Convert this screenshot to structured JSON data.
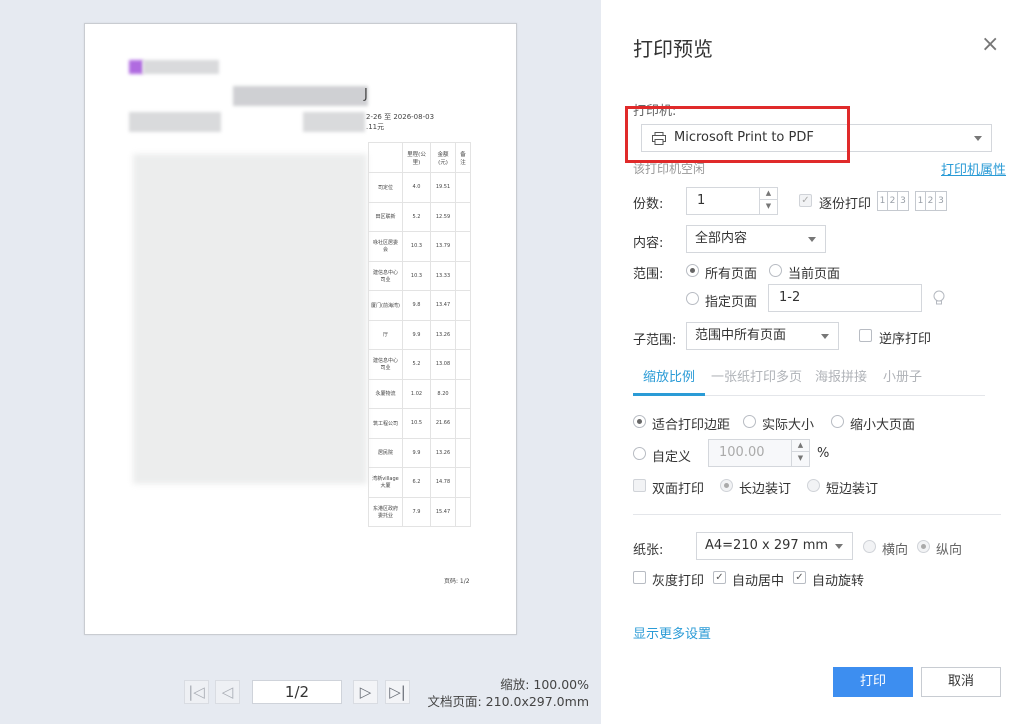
{
  "dialog": {
    "title": "打印预览",
    "close_symbol": "×"
  },
  "printer": {
    "label": "打印机:",
    "value": "Microsoft Print to PDF",
    "status": "该打印机空闲",
    "properties_link": "打印机属性"
  },
  "copies": {
    "label": "份数:",
    "value": "1",
    "collate_label": "逐份打印",
    "collate_checked": true,
    "collate_box_1": [
      "1",
      "2",
      "3"
    ],
    "collate_box_2": [
      "1",
      "2",
      "3"
    ]
  },
  "content": {
    "label": "内容:",
    "value": "全部内容"
  },
  "range": {
    "label": "范围:",
    "all_pages": "所有页面",
    "current_page": "当前页面",
    "specified_pages": "指定页面",
    "pages_value": "1-2"
  },
  "subrange": {
    "label": "子范围:",
    "value": "范围中所有页面",
    "reverse_label": "逆序打印"
  },
  "tabs": [
    {
      "label": "缩放比例",
      "active": true
    },
    {
      "label": "一张纸打印多页",
      "active": false
    },
    {
      "label": "海报拼接",
      "active": false
    },
    {
      "label": "小册子",
      "active": false
    }
  ],
  "scale": {
    "fit_margins": "适合打印边距",
    "actual_size": "实际大小",
    "shrink_large": "缩小大页面",
    "custom": "自定义",
    "custom_value": "100.00",
    "percent": "%",
    "duplex": "双面打印",
    "long_edge": "长边装订",
    "short_edge": "短边装订"
  },
  "paper": {
    "label": "纸张:",
    "value": "A4=210 x 297 mm",
    "landscape": "横向",
    "portrait": "纵向",
    "grayscale": "灰度打印",
    "auto_center": "自动居中",
    "auto_rotate": "自动旋转"
  },
  "more_settings": "显示更多设置",
  "buttons": {
    "print": "打印",
    "cancel": "取消"
  },
  "pager": {
    "page_value": "1/2",
    "first": "|◁",
    "prev": "◁",
    "next": "▷",
    "last": "▷|"
  },
  "zoom": {
    "zoom_text": "缩放: 100.00%",
    "doc_page_text": "文档页面: 210.0x297.0mm"
  },
  "preview": {
    "date_range": "2-26 至 2026-08-03",
    "amount": ".11元",
    "headers": [
      "里程(公里)",
      "金额(元)",
      "备注"
    ],
    "rows": [
      [
        "司定位",
        "4.0",
        "19.51"
      ],
      [
        "田区联新",
        "5.2",
        "12.59"
      ],
      [
        "咏社区居委会",
        "10.3",
        "13.79"
      ],
      [
        "建信息中心司业",
        "10.3",
        "13.33"
      ],
      [
        "厦门(前海湾)",
        "9.8",
        "13.47"
      ],
      [
        "厅",
        "9.9",
        "13.26"
      ],
      [
        "建信息中心司业",
        "5.2",
        "13.08"
      ],
      [
        "永厦物流",
        "1.02",
        "8.20"
      ],
      [
        "筑工程公司",
        "10.5",
        "21.66"
      ],
      [
        "居民院",
        "9.9",
        "13.26"
      ],
      [
        "湾新village大厦",
        "6.2",
        "14.78"
      ],
      [
        "东港区政府委托业",
        "7.9",
        "15.47"
      ]
    ],
    "page_footer": "页码: 1/2"
  }
}
